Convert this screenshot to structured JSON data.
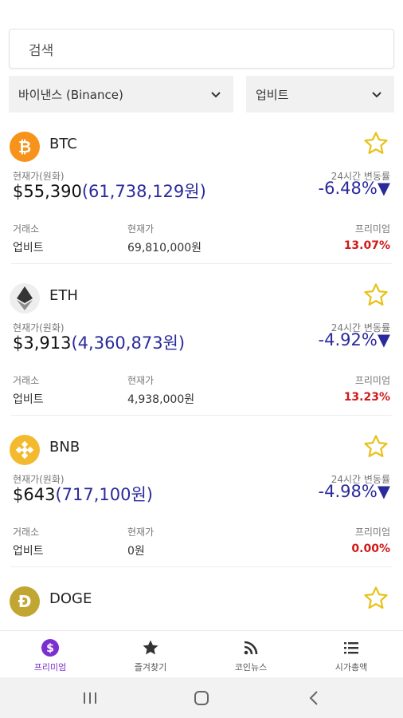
{
  "search": {
    "placeholder": "검색"
  },
  "selectors": {
    "exchange_left": "바이낸스 (Binance)",
    "exchange_right": "업비트"
  },
  "labels": {
    "current_price_krw": "현재가(원화)",
    "change_24h": "24시간 변동률",
    "exchange": "거래소",
    "current_price": "현재가",
    "premium": "프리미엄"
  },
  "coins": [
    {
      "symbol": "BTC",
      "glyph": "₿",
      "color": "#f7931a",
      "price_usd": "$55,390",
      "price_krw": "(61,738,129원)",
      "change": "-6.48%▼",
      "exchange": "업비트",
      "local_price": "69,810,000원",
      "premium": "13.07%"
    },
    {
      "symbol": "ETH",
      "glyph": "◆",
      "color": "#eeeeee",
      "price_usd": "$3,913",
      "price_krw": "(4,360,873원)",
      "change": "-4.92%▼",
      "exchange": "업비트",
      "local_price": "4,938,000원",
      "premium": "13.23%"
    },
    {
      "symbol": "BNB",
      "glyph": "◈",
      "color": "#f3ba2f",
      "price_usd": "$643",
      "price_krw": "(717,100원)",
      "change": "-4.98%▼",
      "exchange": "업비트",
      "local_price": "0원",
      "premium": "0.00%"
    },
    {
      "symbol": "DOGE",
      "glyph": "Ð",
      "color": "#c2a633"
    }
  ],
  "nav": {
    "premium": "프리미엄",
    "favorites": "즐겨찾기",
    "coin_news": "코인뉴스",
    "market_cap": "시가총액"
  },
  "colors": {
    "accent": "#7b2fd0",
    "change_blue": "#2a2a9c",
    "premium_red": "#d11a1a",
    "star_yellow": "#e8c21a"
  }
}
